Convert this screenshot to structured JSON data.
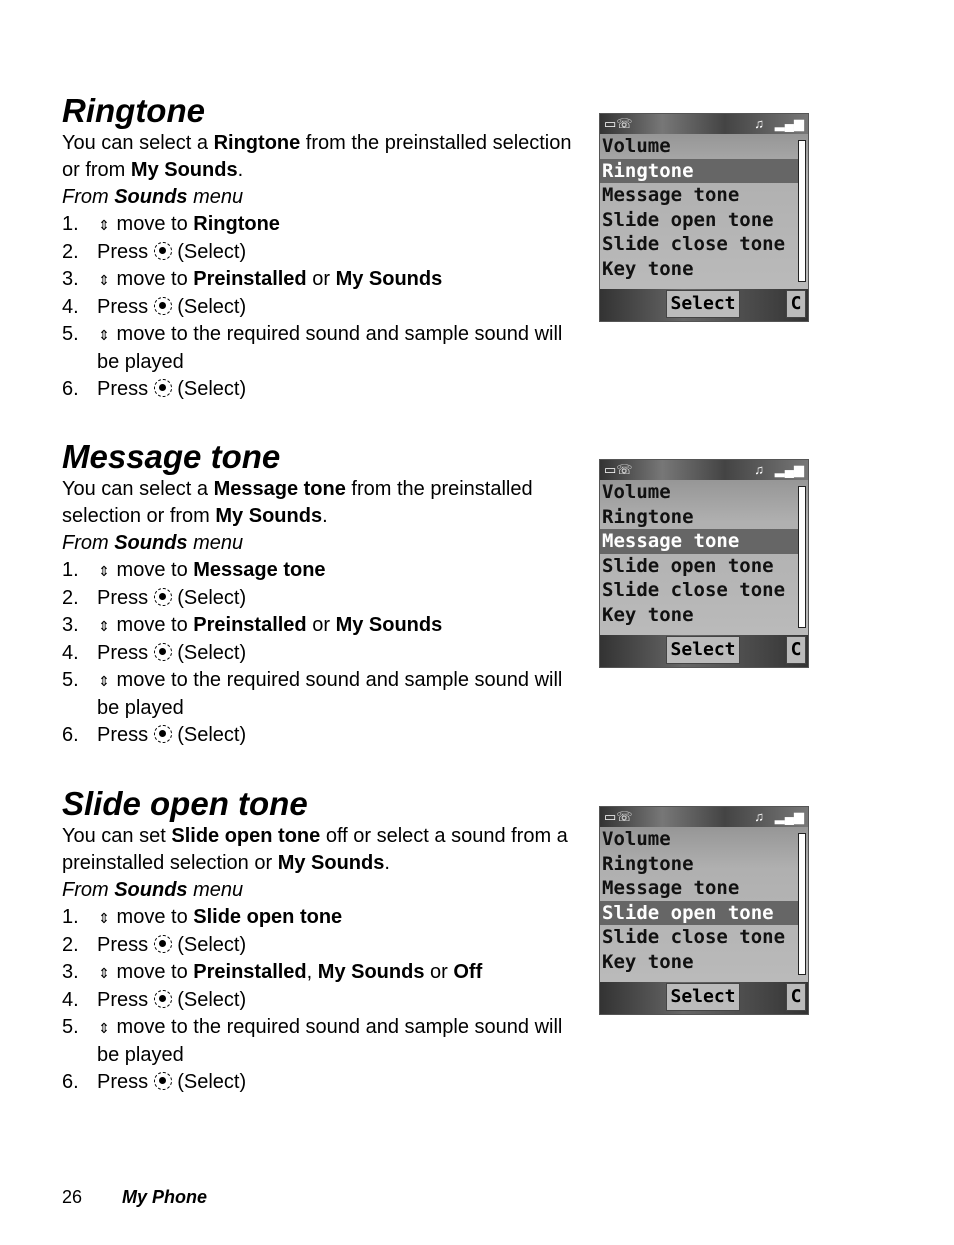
{
  "sections": [
    {
      "title": "Ringtone",
      "intro": [
        "You can select a ",
        "Ringtone",
        " from the preinstalled selection or from ",
        "My Sounds",
        "."
      ],
      "from": [
        "From ",
        "Sounds",
        " menu"
      ],
      "steps": [
        {
          "n": "1.",
          "icon": "nav",
          "text": [
            " move to ",
            "Ringtone",
            ""
          ]
        },
        {
          "n": "2.",
          "icon": "select",
          "pre": "Press ",
          "text": [
            " (Select)"
          ]
        },
        {
          "n": "3.",
          "icon": "nav",
          "text": [
            " move to ",
            "Preinstalled",
            " or ",
            "My Sounds"
          ]
        },
        {
          "n": "4.",
          "icon": "select",
          "pre": "Press ",
          "text": [
            " (Select)"
          ]
        },
        {
          "n": "5.",
          "icon": "nav",
          "text": [
            " move to the required sound and sample sound will be played"
          ]
        },
        {
          "n": "6.",
          "icon": "select",
          "pre": "Press ",
          "text": [
            " (Select)"
          ]
        }
      ],
      "screen": {
        "items": [
          "Volume",
          "Ringtone",
          "Message tone",
          "Slide open tone",
          "Slide close tone",
          "Key tone"
        ],
        "highlight": 1,
        "softkey": "Select",
        "clear": "C"
      }
    },
    {
      "title": "Message tone",
      "intro": [
        "You can select a ",
        "Message tone",
        " from the preinstalled selection or from ",
        "My Sounds",
        "."
      ],
      "from": [
        "From ",
        "Sounds",
        " menu"
      ],
      "steps": [
        {
          "n": "1.",
          "icon": "nav",
          "text": [
            " move to ",
            "Message tone",
            ""
          ]
        },
        {
          "n": "2.",
          "icon": "select",
          "pre": "Press ",
          "text": [
            " (Select)"
          ]
        },
        {
          "n": "3.",
          "icon": "nav",
          "text": [
            " move to ",
            "Preinstalled",
            " or ",
            "My Sounds"
          ]
        },
        {
          "n": "4.",
          "icon": "select",
          "pre": "Press ",
          "text": [
            " (Select)"
          ]
        },
        {
          "n": "5.",
          "icon": "nav",
          "text": [
            " move to the required sound and sample sound will be played"
          ]
        },
        {
          "n": "6.",
          "icon": "select",
          "pre": "Press ",
          "text": [
            " (Select)"
          ]
        }
      ],
      "screen": {
        "items": [
          "Volume",
          "Ringtone",
          "Message tone",
          "Slide open tone",
          "Slide close tone",
          "Key tone"
        ],
        "highlight": 2,
        "softkey": "Select",
        "clear": "C"
      }
    },
    {
      "title": "Slide open tone",
      "intro": [
        "You can set ",
        "Slide open tone",
        " off or select a sound from a preinstalled selection or ",
        "My Sounds",
        "."
      ],
      "from": [
        "From ",
        "Sounds",
        " menu"
      ],
      "steps": [
        {
          "n": "1.",
          "icon": "nav",
          "text": [
            " move to ",
            "Slide open tone",
            ""
          ]
        },
        {
          "n": "2.",
          "icon": "select",
          "pre": "Press ",
          "text": [
            " (Select)"
          ]
        },
        {
          "n": "3.",
          "icon": "nav",
          "text": [
            " move to ",
            "Preinstalled",
            ", ",
            "My Sounds",
            " or ",
            "Off"
          ]
        },
        {
          "n": "4.",
          "icon": "select",
          "pre": "Press ",
          "text": [
            " (Select)"
          ]
        },
        {
          "n": "5.",
          "icon": "nav",
          "text": [
            " move to the required sound and sample sound will be played"
          ]
        },
        {
          "n": "6.",
          "icon": "select",
          "pre": "Press ",
          "text": [
            " (Select)"
          ]
        }
      ],
      "screen": {
        "items": [
          "Volume",
          "Ringtone",
          "Message tone",
          "Slide open tone",
          "Slide close tone",
          "Key tone"
        ],
        "highlight": 3,
        "softkey": "Select",
        "clear": "C"
      }
    }
  ],
  "footer": {
    "page": "26",
    "chapter": "My Phone"
  }
}
